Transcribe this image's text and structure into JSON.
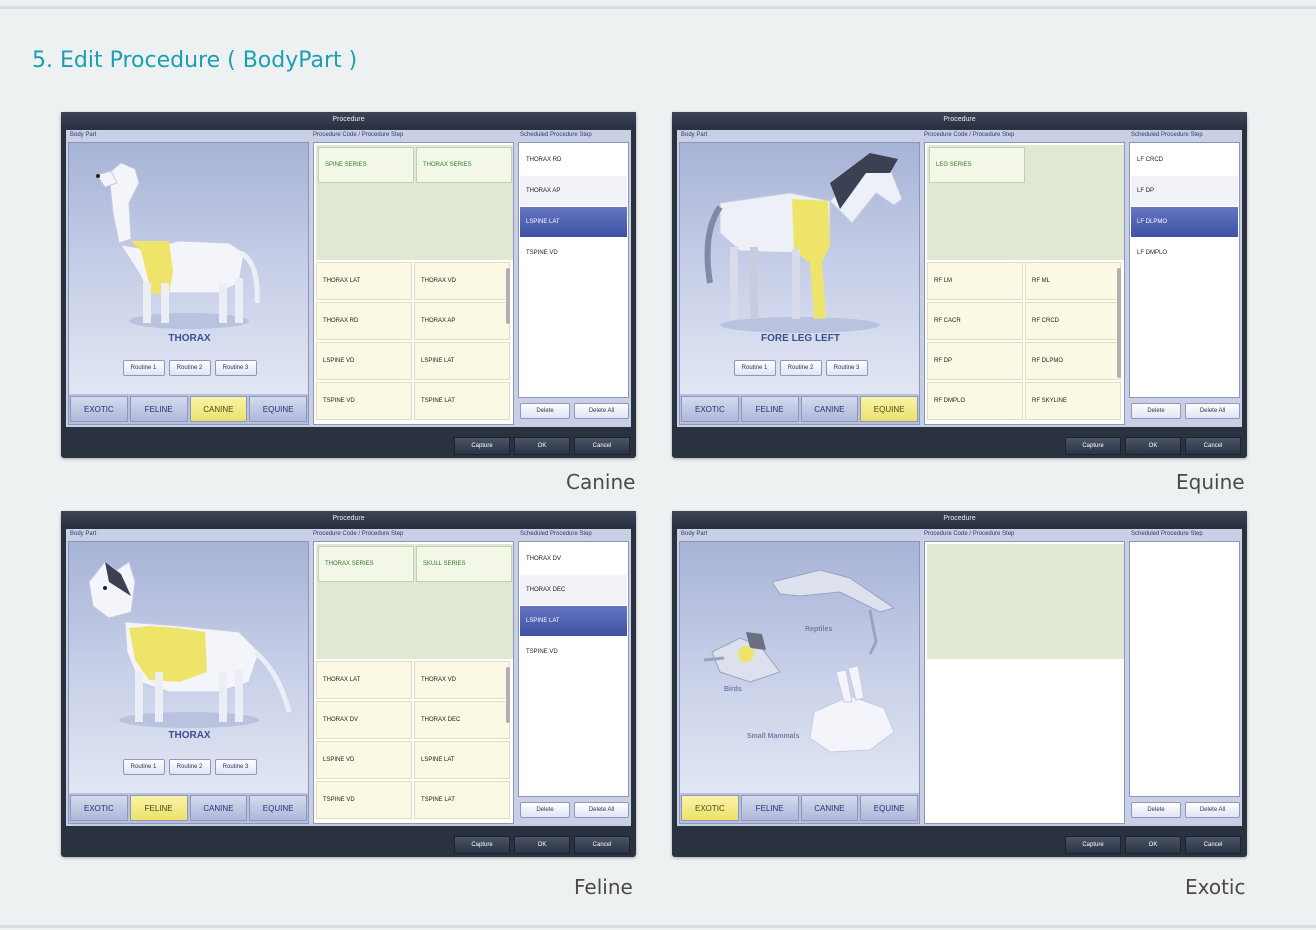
{
  "page_title": {
    "num": "5.",
    "text": " Edit Procedure ( BodyPart )"
  },
  "labels": {
    "window_title": "Procedure",
    "body_part": "Body Part",
    "procedure_code": "Procedure Code / Procedure Step",
    "scheduled": "Scheduled Procedure Step",
    "delete": "Delete",
    "delete_all": "Delete All",
    "capture": "Capture",
    "ok": "OK",
    "cancel": "Cancel",
    "routine1": "Routine 1",
    "routine2": "Routine 2",
    "routine3": "Routine 3",
    "exotic": "EXOTIC",
    "feline": "FELINE",
    "canine": "CANINE",
    "equine": "EQUINE"
  },
  "panels": {
    "canine": {
      "caption": "Canine",
      "part_label": "THORAX",
      "series": [
        "SPINE SERIES",
        "THORAX SERIES"
      ],
      "steps": [
        "THORAX LAT",
        "THORAX VD",
        "THORAX RD",
        "THORAX AP",
        "LSPINE VD",
        "LSPINE LAT",
        "TSPINE VD",
        "TSPINE LAT"
      ],
      "scheduled": [
        "THORAX RD",
        "THORAX AP",
        "LSPINE LAT",
        "TSPINE VD"
      ]
    },
    "equine": {
      "caption": "Equine",
      "part_label": "FORE LEG LEFT",
      "series": [
        "LEG SERIES"
      ],
      "steps": [
        "RF LM",
        "RF ML",
        "RF CACR",
        "RF CRCD",
        "RF DP",
        "RF DLPMO",
        "RF DMPLO",
        "RF SKYLINE"
      ],
      "scheduled": [
        "LF CRCD",
        "LF DP",
        "LF DLPMO",
        "LF DMPLO"
      ]
    },
    "feline": {
      "caption": "Feline",
      "part_label": "THORAX",
      "series": [
        "THORAX SERIES",
        "SKULL SERIES"
      ],
      "steps": [
        "THORAX LAT",
        "THORAX VD",
        "THORAX DV",
        "THORAX DEC",
        "LSPINE VD",
        "LSPINE LAT",
        "TSPINE VD",
        "TSPINE LAT"
      ],
      "scheduled": [
        "THORAX DV",
        "THORAX DEC",
        "LSPINE LAT",
        "TSPINE VD"
      ]
    },
    "exotic": {
      "caption": "Exotic",
      "groups": {
        "reptiles": "Reptiles",
        "birds": "Birds",
        "small_mammals": "Small Mammals"
      }
    }
  },
  "colors": {
    "accent": "#1aa0b0",
    "selected": "#3e51a3",
    "highlight": "#ece16a"
  }
}
